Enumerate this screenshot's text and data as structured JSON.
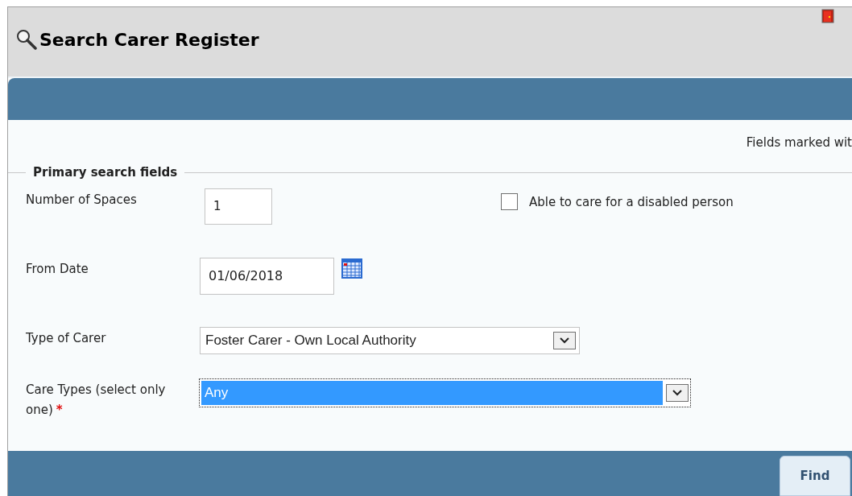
{
  "window": {
    "title": "Search Carer Register"
  },
  "notice": "Fields marked wit",
  "fieldset": {
    "legend": "Primary search fields"
  },
  "fields": [
    {
      "kind": "number",
      "label": "Number of Spaces",
      "value": "1"
    },
    {
      "kind": "date",
      "label": "From Date",
      "value": "01/06/2018"
    },
    {
      "kind": "select",
      "label": "Type of Carer",
      "value": "Foster Carer - Own Local Authority",
      "focused": false
    },
    {
      "kind": "select",
      "label": "Care Types (select only one)",
      "required_mark": "*",
      "value": "Any",
      "focused": true
    }
  ],
  "checkbox": {
    "label": "Able to care for a disabled person",
    "checked": false
  },
  "buttons": [
    "Find"
  ]
}
